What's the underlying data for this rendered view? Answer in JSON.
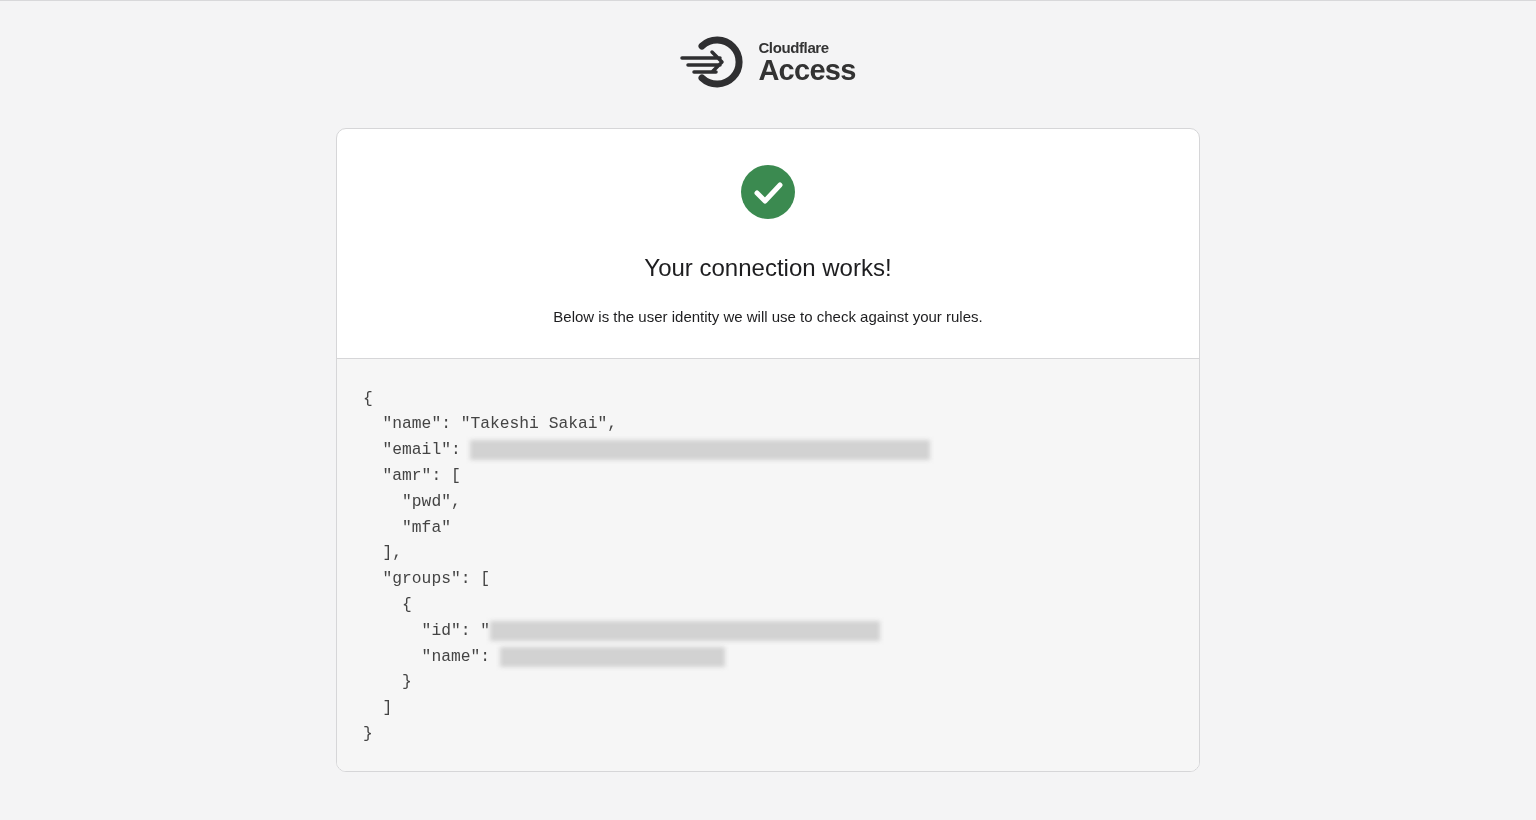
{
  "brand": {
    "small": "Cloudflare",
    "large": "Access"
  },
  "status": {
    "success": true,
    "title": "Your connection works!",
    "subtitle": "Below is the user identity we will use to check against your rules."
  },
  "identity_lines": [
    {
      "text": "{",
      "redacted": false
    },
    {
      "text": "  \"name\": \"Takeshi Sakai\",",
      "redacted": false
    },
    {
      "text": "  \"email\": ",
      "redacted": true
    },
    {
      "text": "  \"amr\": [",
      "redacted": false
    },
    {
      "text": "    \"pwd\",",
      "redacted": false
    },
    {
      "text": "    \"mfa\"",
      "redacted": false
    },
    {
      "text": "  ],",
      "redacted": false
    },
    {
      "text": "  \"groups\": [",
      "redacted": false
    },
    {
      "text": "    {",
      "redacted": false
    },
    {
      "text": "      \"id\": \"",
      "redacted": true
    },
    {
      "text": "      \"name\": ",
      "redacted": true
    },
    {
      "text": "    }",
      "redacted": false
    },
    {
      "text": "  ]",
      "redacted": false
    },
    {
      "text": "}",
      "redacted": false
    }
  ]
}
